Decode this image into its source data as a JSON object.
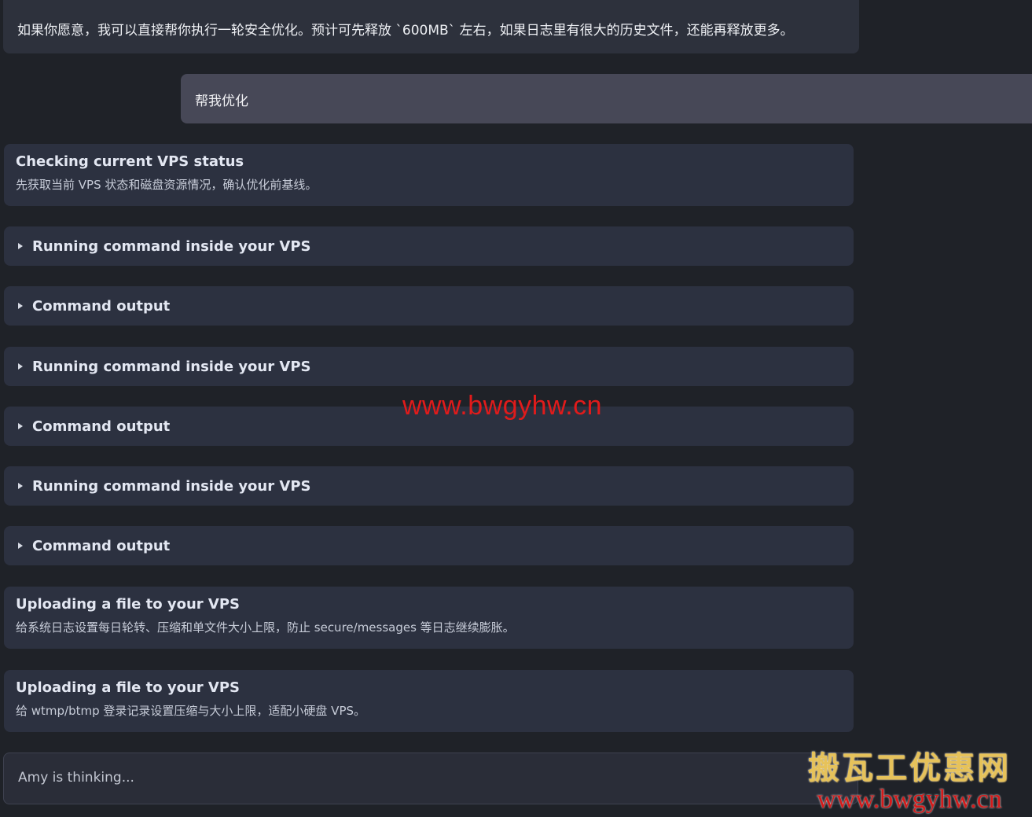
{
  "chat": {
    "assistant_message": "如果你愿意，我可以直接帮你执行一轮安全优化。预计可先释放 `600MB` 左右，如果日志里有很大的历史文件，还能再释放更多。",
    "user_message": "帮我优化"
  },
  "steps": [
    {
      "type": "step",
      "title": "Checking current VPS status",
      "desc": "先获取当前 VPS 状态和磁盘资源情况，确认优化前基线。"
    },
    {
      "type": "collapsible",
      "label": "Running command inside your VPS"
    },
    {
      "type": "collapsible",
      "label": "Command output"
    },
    {
      "type": "collapsible",
      "label": "Running command inside your VPS"
    },
    {
      "type": "collapsible",
      "label": "Command output"
    },
    {
      "type": "collapsible",
      "label": "Running command inside your VPS"
    },
    {
      "type": "collapsible",
      "label": "Command output"
    },
    {
      "type": "step",
      "title": "Uploading a file to your VPS",
      "desc": "给系统日志设置每日轮转、压缩和单文件大小上限，防止 secure/messages 等日志继续膨胀。"
    },
    {
      "type": "step",
      "title": "Uploading a file to your VPS",
      "desc": "给 wtmp/btmp 登录记录设置压缩与大小上限，适配小硬盘 VPS。"
    }
  ],
  "status": {
    "text": "Amy is thinking..."
  },
  "watermark": {
    "center_url": "www.bwgyhw.cn",
    "logo_text": "搬瓦工优惠网",
    "logo_url": "www.bwgyhw.cn"
  },
  "colors": {
    "background": "#1f2228",
    "card": "#2c3140",
    "user_bubble": "#474857",
    "watermark_red": "#e01b1b",
    "logo_gold": "#e6c25a"
  }
}
